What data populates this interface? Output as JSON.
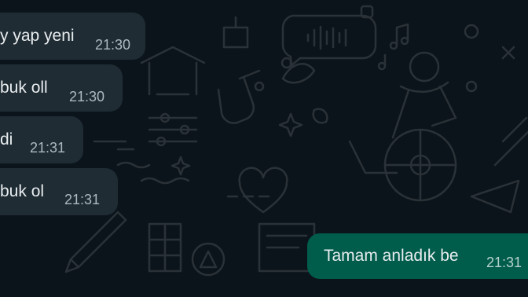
{
  "messages": [
    {
      "direction": "incoming",
      "text": "y yap yeni",
      "time": "21:30"
    },
    {
      "direction": "incoming",
      "text": "buk oll",
      "time": "21:30"
    },
    {
      "direction": "incoming",
      "text": "di",
      "time": "21:31"
    },
    {
      "direction": "incoming",
      "text": "buk ol",
      "time": "21:31"
    },
    {
      "direction": "outgoing",
      "text": "Tamam anladık be",
      "time": "21:31"
    }
  ],
  "colors": {
    "background": "#0b141a",
    "incoming_bubble": "#1f2c34",
    "outgoing_bubble": "#005c4b",
    "timestamp": "#aebac1"
  }
}
